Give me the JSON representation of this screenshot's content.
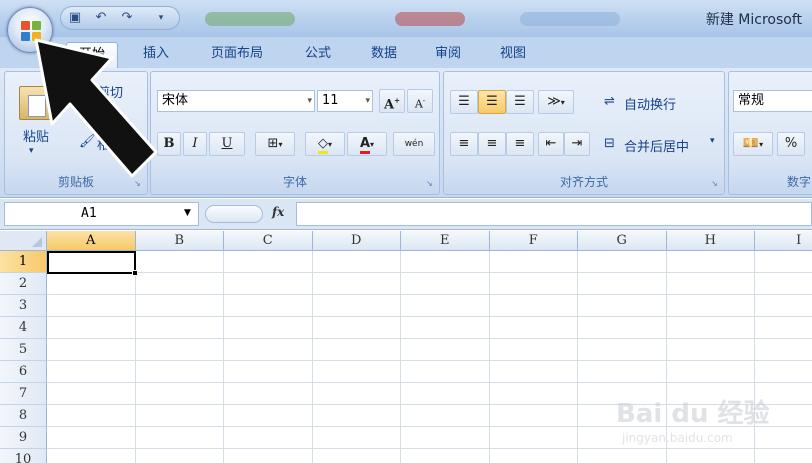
{
  "window": {
    "title": "新建 Microsoft"
  },
  "tabs": [
    {
      "label": "开始",
      "active": true
    },
    {
      "label": "插入"
    },
    {
      "label": "页面布局"
    },
    {
      "label": "公式"
    },
    {
      "label": "数据"
    },
    {
      "label": "审阅"
    },
    {
      "label": "视图"
    }
  ],
  "ribbon": {
    "clipboard": {
      "paste_label": "粘贴",
      "cut_label": "剪切",
      "copy_label": "复制",
      "format_painter_label": "格式刷",
      "group_label": "剪贴板"
    },
    "font": {
      "font_name": "宋体",
      "font_size": "11",
      "grow": "A",
      "shrink": "A",
      "bold": "B",
      "italic": "I",
      "underline": "U",
      "font_color": "A",
      "phonetic": "wén",
      "group_label": "字体"
    },
    "alignment": {
      "wrap_text_label": "自动换行",
      "merge_center_label": "合并后居中",
      "group_label": "对齐方式"
    },
    "number": {
      "format": "常规",
      "percent": "%",
      "group_label": "数字"
    }
  },
  "formula_bar": {
    "name_box": "A1",
    "fx": "fx",
    "formula": ""
  },
  "grid": {
    "columns": [
      "A",
      "B",
      "C",
      "D",
      "E",
      "F",
      "G",
      "H",
      "I"
    ],
    "rows": [
      "1",
      "2",
      "3",
      "4",
      "5",
      "6",
      "7",
      "8",
      "9",
      "10"
    ],
    "active_cell": "A1"
  },
  "colors": {
    "accent": "#15428b",
    "selected_header": "#f7c869",
    "ribbon": "#dbe6f5"
  },
  "watermark": {
    "text": "Bai du 经验",
    "sub": "jingyan.baidu.com"
  }
}
